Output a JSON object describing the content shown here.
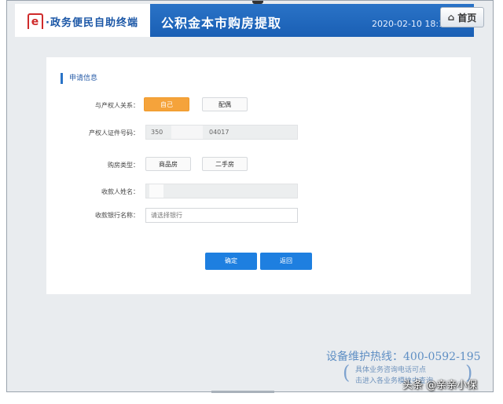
{
  "header": {
    "logo_mark": "e",
    "logo_text": "·政务便民自助终端",
    "title": "公积金本市购房提取",
    "datetime": "2020-02-10 18:15",
    "home_label": "首页"
  },
  "form": {
    "section_title": "申请信息",
    "relation": {
      "label": "与产权人关系：",
      "options": [
        "自己",
        "配偶"
      ],
      "selected": "自己"
    },
    "id_number": {
      "label": "产权人证件号码：",
      "value_start": "350",
      "value_end": "04017"
    },
    "house_type": {
      "label": "购房类型：",
      "options": [
        "商品房",
        "二手房"
      ]
    },
    "payee_name": {
      "label": "收款人姓名："
    },
    "bank_name": {
      "label": "收款银行名称：",
      "placeholder": "请选择银行"
    },
    "confirm_label": "确定",
    "back_label": "返回"
  },
  "footer": {
    "hotline": "设备维护热线：400-0592-195",
    "tip_line1": "具体业务咨询电话可点",
    "tip_line2": "击进入各业务模块中查询"
  },
  "watermark": "头条 @亲亲小保"
}
